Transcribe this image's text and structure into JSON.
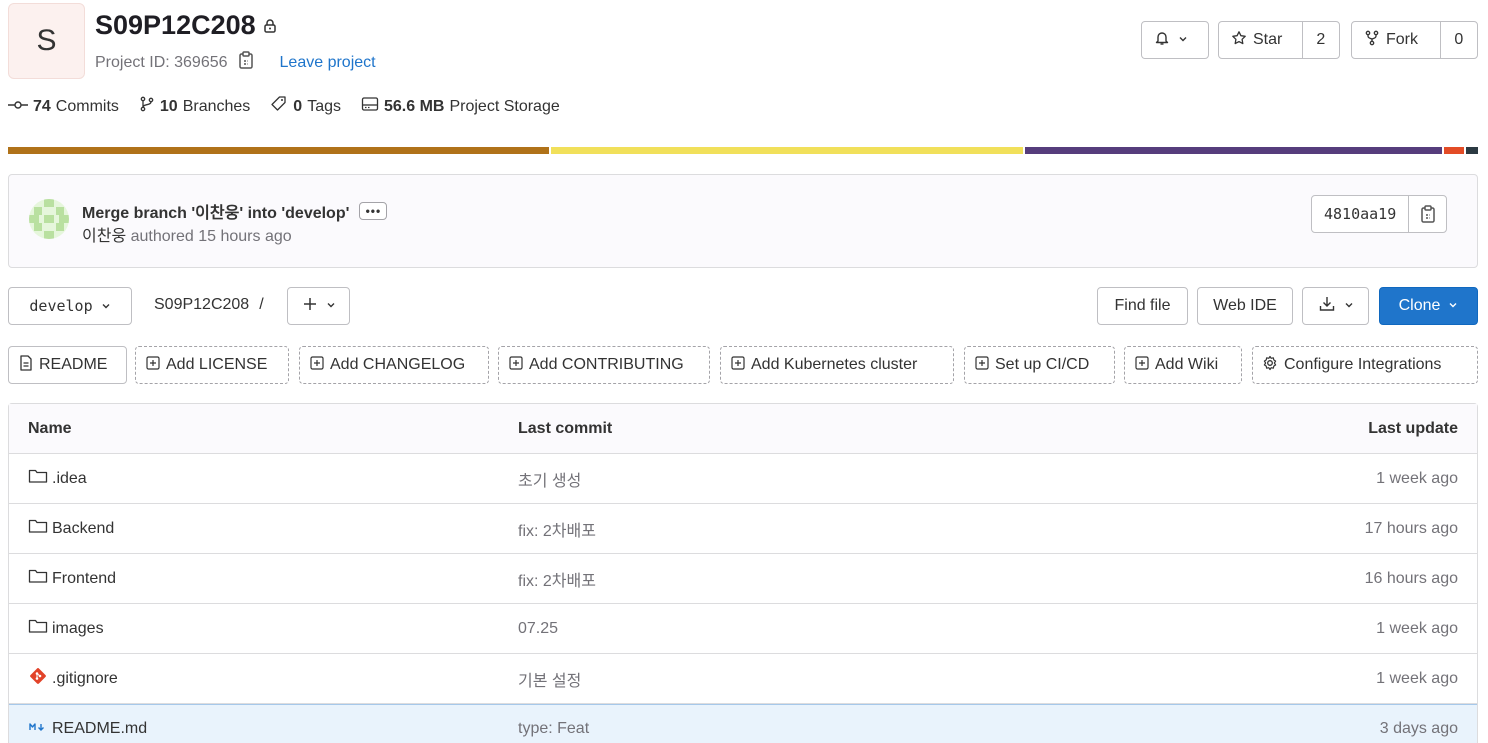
{
  "project": {
    "avatar_letter": "S",
    "name": "S09P12C208",
    "id_label": "Project ID: 369656",
    "leave_label": "Leave project"
  },
  "header_buttons": {
    "star_label": "Star",
    "star_count": "2",
    "fork_label": "Fork",
    "fork_count": "0"
  },
  "stats": {
    "commits_count": "74",
    "commits_label": "Commits",
    "branches_count": "10",
    "branches_label": "Branches",
    "tags_count": "0",
    "tags_label": "Tags",
    "storage_size": "56.6 MB",
    "storage_label": "Project Storage"
  },
  "language_bar": [
    {
      "color": "#b07219",
      "share": 37
    },
    {
      "color": "#f1e05a",
      "share": 32.3
    },
    {
      "color": "#563d7c",
      "share": 28.5
    },
    {
      "color": "#e34c26",
      "share": 1.4
    },
    {
      "color": "#2b3a42",
      "share": 0.8
    }
  ],
  "last_commit": {
    "title": "Merge branch '이찬웅' into 'develop'",
    "author": "이찬웅",
    "meta": "authored 15 hours ago",
    "sha": "4810aa19"
  },
  "toolbar": {
    "branch": "develop",
    "path_root": "S09P12C208",
    "path_sep": "/",
    "find_file": "Find file",
    "web_ide": "Web IDE",
    "clone": "Clone"
  },
  "shortcuts": [
    "README",
    "Add LICENSE",
    "Add CHANGELOG",
    "Add CONTRIBUTING",
    "Add Kubernetes cluster",
    "Set up CI/CD",
    "Add Wiki",
    "Configure Integrations"
  ],
  "table": {
    "headers": {
      "name": "Name",
      "last_commit": "Last commit",
      "last_update": "Last update"
    },
    "rows": [
      {
        "name": ".idea",
        "icon": "folder-icon",
        "commit": "초기 생성",
        "updated": "1 week ago"
      },
      {
        "name": "Backend",
        "icon": "folder-icon",
        "commit": "fix: 2차배포",
        "updated": "17 hours ago"
      },
      {
        "name": "Frontend",
        "icon": "folder-icon",
        "commit": "fix: 2차배포",
        "updated": "16 hours ago"
      },
      {
        "name": "images",
        "icon": "folder-icon",
        "commit": "07.25",
        "updated": "1 week ago"
      },
      {
        "name": ".gitignore",
        "icon": "git-icon",
        "commit": "기본 설정",
        "updated": "1 week ago"
      },
      {
        "name": "README.md",
        "icon": "markdown-icon",
        "commit": "type: Feat",
        "updated": "3 days ago"
      }
    ]
  },
  "colors": {
    "accent": "#1f75cb",
    "git_icon": "#e24329"
  }
}
